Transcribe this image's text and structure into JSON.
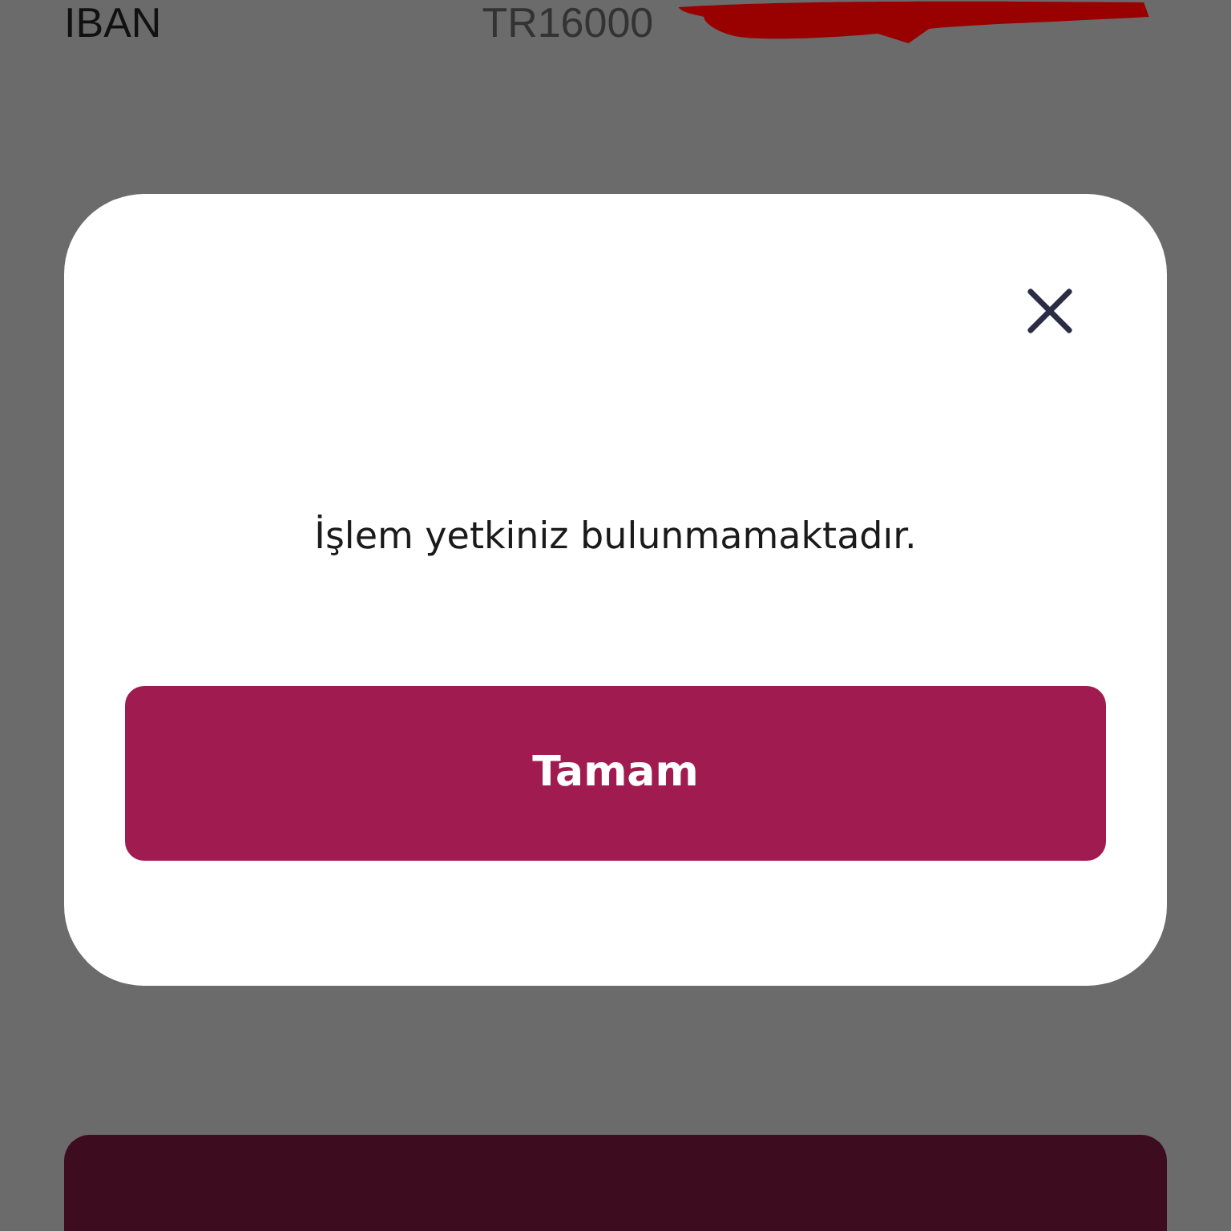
{
  "background_row": {
    "label": "IBAN",
    "value": "TR16000"
  },
  "dialog": {
    "message": "İşlem yetkiniz bulunmamaktadır.",
    "button": "Tamam"
  }
}
